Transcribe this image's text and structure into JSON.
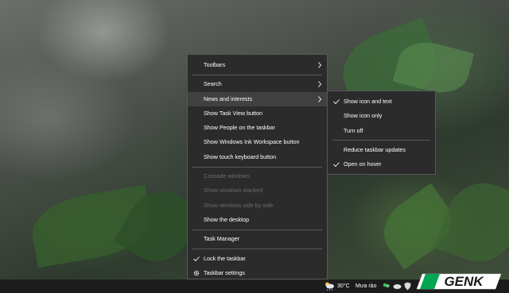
{
  "context_menu": {
    "items": [
      {
        "label": "Toolbars"
      },
      {
        "label": "Search"
      },
      {
        "label": "News and interests"
      },
      {
        "label": "Show Task View button"
      },
      {
        "label": "Show People on the taskbar"
      },
      {
        "label": "Show Windows Ink Workspace button"
      },
      {
        "label": "Show touch keyboard button"
      },
      {
        "label": "Cascade windows"
      },
      {
        "label": "Show windows stacked"
      },
      {
        "label": "Show windows side by side"
      },
      {
        "label": "Show the desktop"
      },
      {
        "label": "Task Manager"
      },
      {
        "label": "Lock the taskbar"
      },
      {
        "label": "Taskbar settings"
      }
    ]
  },
  "submenu": {
    "items": [
      {
        "label": "Show icon and text"
      },
      {
        "label": "Show icon only"
      },
      {
        "label": "Turn off"
      },
      {
        "label": "Reduce taskbar updates"
      },
      {
        "label": "Open on hover"
      }
    ]
  },
  "taskbar": {
    "weather_temp": "30°C",
    "weather_desc": "Mưa rào"
  },
  "watermark": {
    "brand": "GENK"
  },
  "colors": {
    "menu_bg": "#2b2b2b",
    "hover_bg": "#414141",
    "disabled_text": "#6c6c6c",
    "brand_green": "#00a651"
  }
}
